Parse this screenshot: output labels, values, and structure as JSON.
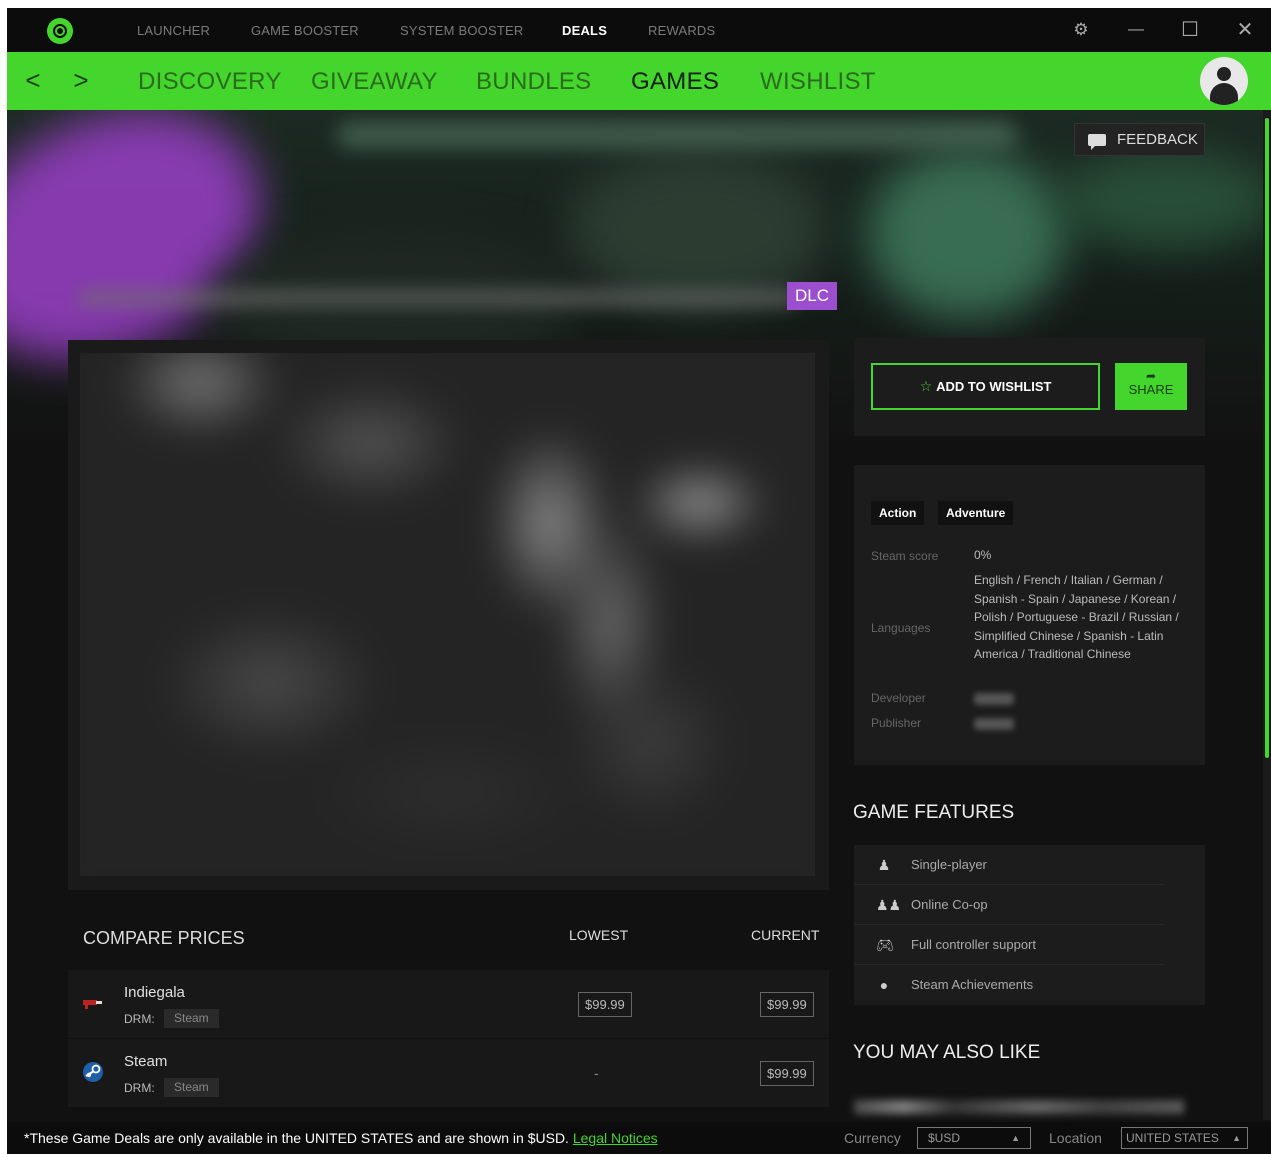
{
  "topnav": [
    {
      "label": "LAUNCHER"
    },
    {
      "label": "GAME BOOSTER"
    },
    {
      "label": "SYSTEM BOOSTER"
    },
    {
      "label": "DEALS"
    },
    {
      "label": "REWARDS"
    }
  ],
  "window_controls": {
    "settings": "⚙",
    "minimize": "—",
    "maximize": "☐",
    "close": "✕"
  },
  "subnav": {
    "back": "<",
    "forward": ">",
    "items": [
      {
        "label": "DISCOVERY"
      },
      {
        "label": "GIVEAWAY"
      },
      {
        "label": "BUNDLES"
      },
      {
        "label": "GAMES"
      },
      {
        "label": "WISHLIST"
      }
    ]
  },
  "hero": {
    "feedback_label": "FEEDBACK",
    "badge": "DLC"
  },
  "compare": {
    "title": "COMPARE PRICES",
    "col_lowest": "LOWEST",
    "col_current": "CURRENT",
    "drm_label": "DRM:",
    "rows": [
      {
        "store": "Indiegala",
        "drm": "Steam",
        "lowest": "$99.99",
        "current": "$99.99"
      },
      {
        "store": "Steam",
        "drm": "Steam",
        "lowest": "-",
        "current": "$99.99"
      }
    ]
  },
  "actions": {
    "wishlist_label": "ADD TO WISHLIST",
    "share_label": "SHARE"
  },
  "info": {
    "genres": [
      "Action",
      "Adventure"
    ],
    "steam_score_label": "Steam score",
    "steam_score_value": "0%",
    "languages_label": "Languages",
    "languages_value": "English / French / Italian / German / Spanish - Spain / Japanese / Korean / Polish / Portuguese - Brazil / Russian / Simplified Chinese / Spanish - Latin America / Traditional Chinese",
    "developer_label": "Developer",
    "publisher_label": "Publisher"
  },
  "features": {
    "title": "GAME FEATURES",
    "items": [
      {
        "label": "Single-player",
        "icon": "person-icon"
      },
      {
        "label": "Online Co-op",
        "icon": "users-icon"
      },
      {
        "label": "Full controller support",
        "icon": "gamepad-icon"
      },
      {
        "label": "Steam Achievements",
        "icon": "trophy-icon"
      }
    ]
  },
  "also_like_title": "YOU MAY ALSO LIKE",
  "footer": {
    "disclaimer": "*These Game Deals are only available in the UNITED STATES and are shown in $USD.",
    "legal_link": "Legal Notices",
    "currency_label": "Currency",
    "currency_value": "$USD",
    "location_label": "Location",
    "location_value": "UNITED STATES"
  },
  "colors": {
    "accent": "#44d62c",
    "dlc_badge": "#9b4fcf",
    "background": "#111111"
  }
}
